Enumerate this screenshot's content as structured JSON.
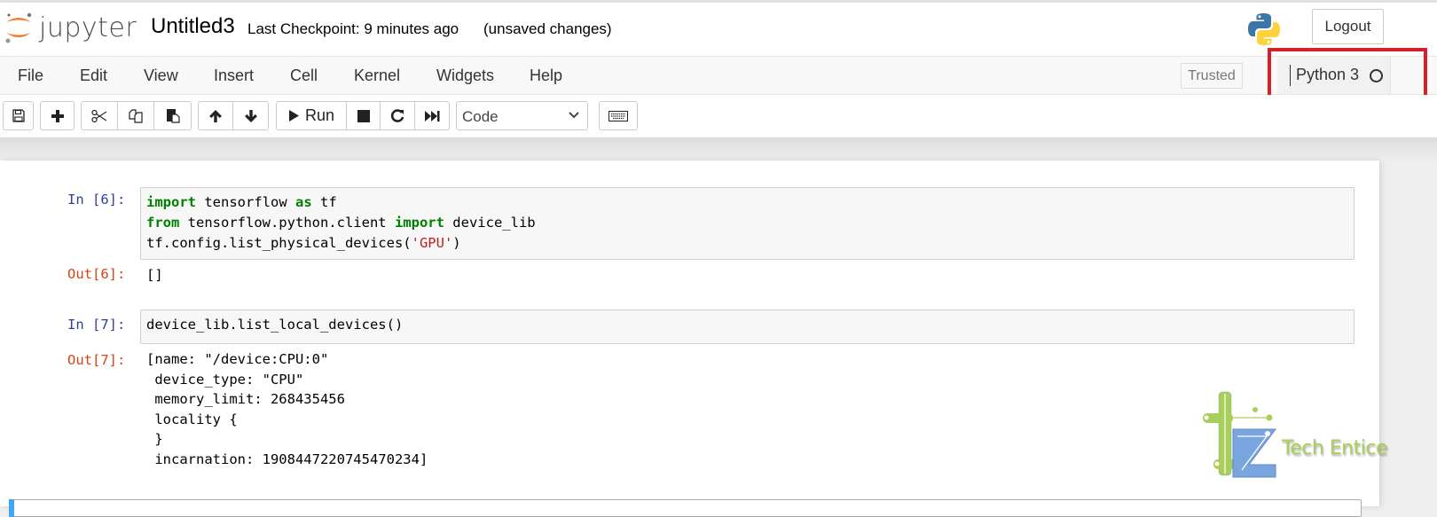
{
  "header": {
    "logo_text": "jupyter",
    "notebook_title": "Untitled3",
    "checkpoint_text": "Last Checkpoint: 9 minutes ago",
    "save_status": "(unsaved changes)",
    "logout_label": "Logout"
  },
  "menubar": {
    "items": [
      "File",
      "Edit",
      "View",
      "Insert",
      "Cell",
      "Kernel",
      "Widgets",
      "Help"
    ],
    "trusted_label": "Trusted",
    "kernel_name": "Python 3",
    "kernel_status": "idle"
  },
  "toolbar": {
    "buttons": [
      "save-icon",
      "plus-icon",
      "cut-icon",
      "copy-icon",
      "paste-icon",
      "arrow-up-icon",
      "arrow-down-icon",
      "run",
      "stop-icon",
      "restart-icon",
      "fast-forward-icon",
      "keyboard-icon"
    ],
    "run_label": "Run",
    "cell_type_selected": "Code"
  },
  "colors": {
    "highlight_box": "#d8202a",
    "in_prompt": "#303f9f",
    "out_prompt": "#d84315",
    "keyword": "#008000",
    "string": "#ba2121",
    "selected_cell_bar": "#42a5f5"
  },
  "cells": [
    {
      "in_prompt": "In [6]:",
      "code_lines": [
        [
          {
            "t": "import",
            "k": "kw"
          },
          {
            "t": " tensorflow ",
            "k": ""
          },
          {
            "t": "as",
            "k": "kw"
          },
          {
            "t": " tf",
            "k": ""
          }
        ],
        [
          {
            "t": "from",
            "k": "kw"
          },
          {
            "t": " tensorflow.python.client ",
            "k": ""
          },
          {
            "t": "import",
            "k": "kw"
          },
          {
            "t": " device_lib",
            "k": ""
          }
        ],
        [
          {
            "t": "tf.config.list_physical_devices(",
            "k": ""
          },
          {
            "t": "'GPU'",
            "k": "str"
          },
          {
            "t": ")",
            "k": ""
          }
        ]
      ],
      "out_prompt": "Out[6]:",
      "output": "[]"
    },
    {
      "in_prompt": "In [7]:",
      "code_lines": [
        [
          {
            "t": "device_lib.list_local_devices()",
            "k": ""
          }
        ]
      ],
      "out_prompt": "Out[7]:",
      "output": "[name: \"/device:CPU:0\"\n device_type: \"CPU\"\n memory_limit: 268435456\n locality {\n }\n incarnation: 1908447220745470234]"
    }
  ],
  "watermark": {
    "text": "Tech Entice"
  }
}
